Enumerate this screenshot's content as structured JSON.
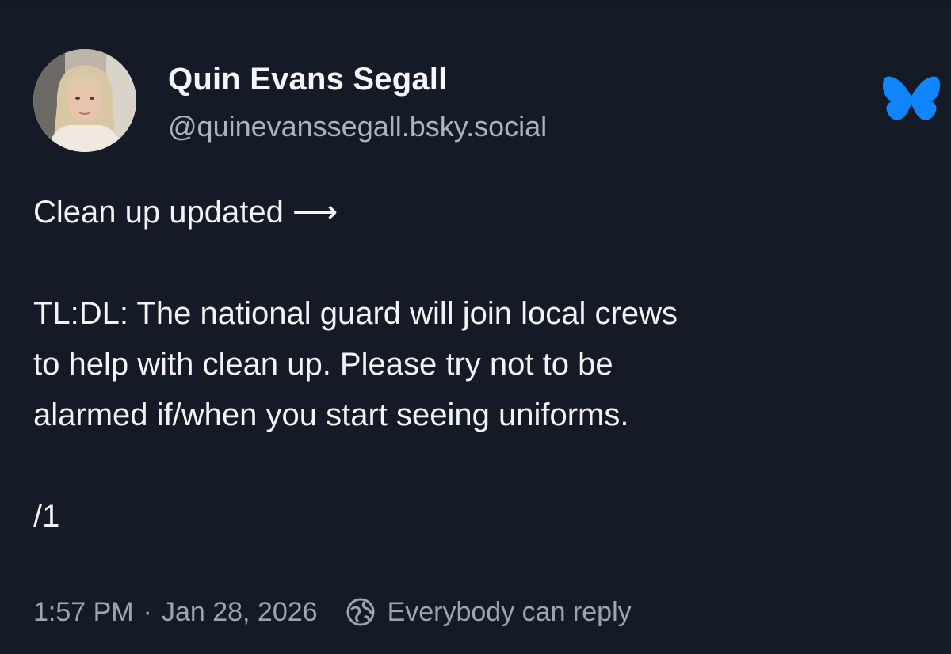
{
  "author": {
    "display_name": "Quin Evans Segall",
    "handle": "@quinevanssegall.bsky.social",
    "avatar_icon": "profile-photo"
  },
  "platform": {
    "logo_icon": "butterfly-icon",
    "accent_color": "#1185fe"
  },
  "post": {
    "first_line": "Clean up updated ⟶",
    "tldl_lines": [
      "TL:DL: The national guard will join local crews",
      "to help with clean up. Please try not to be",
      "alarmed if/when you start seeing uniforms."
    ],
    "thread_marker": "/1"
  },
  "meta": {
    "time": "1:57 PM",
    "separator": "·",
    "date": "Jan 28, 2026",
    "reply_icon": "globe-icon",
    "reply_setting": "Everybody can reply"
  },
  "colors": {
    "background": "#151b26",
    "text": "#f1f3f5",
    "muted": "#9aa6b5"
  }
}
